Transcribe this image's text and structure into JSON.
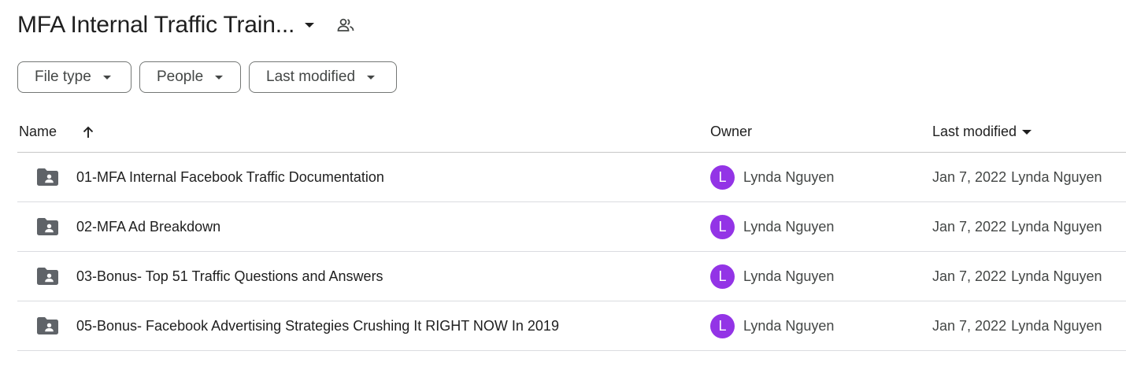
{
  "header": {
    "title": "MFA Internal Traffic Train...",
    "title_menu_icon": "caret-down-icon",
    "shared_icon": "people-icon"
  },
  "filters": [
    {
      "label": "File type"
    },
    {
      "label": "People"
    },
    {
      "label": "Last modified"
    }
  ],
  "table": {
    "columns": {
      "name": "Name",
      "owner": "Owner",
      "last_modified": "Last modified"
    },
    "sort": {
      "column": "Name",
      "direction": "ascending",
      "icon": "arrow-up-icon"
    },
    "rows": [
      {
        "icon": "shared-folder-icon",
        "name": "01-MFA Internal Facebook Traffic Documentation",
        "owner_initial": "L",
        "owner": "Lynda Nguyen",
        "modified_date": "Jan 7, 2022",
        "modified_by": "Lynda Nguyen"
      },
      {
        "icon": "shared-folder-icon",
        "name": "02-MFA Ad Breakdown",
        "owner_initial": "L",
        "owner": "Lynda Nguyen",
        "modified_date": "Jan 7, 2022",
        "modified_by": "Lynda Nguyen"
      },
      {
        "icon": "shared-folder-icon",
        "name": "03-Bonus- Top 51 Traffic Questions and Answers",
        "owner_initial": "L",
        "owner": "Lynda Nguyen",
        "modified_date": "Jan 7, 2022",
        "modified_by": "Lynda Nguyen"
      },
      {
        "icon": "shared-folder-icon",
        "name": "05-Bonus- Facebook Advertising Strategies Crushing It RIGHT NOW In 2019",
        "owner_initial": "L",
        "owner": "Lynda Nguyen",
        "modified_date": "Jan 7, 2022",
        "modified_by": "Lynda Nguyen"
      }
    ]
  },
  "colors": {
    "avatar": "#9334e6",
    "text_primary": "#1f1f1f",
    "text_secondary": "#444746",
    "icon": "#5f6368",
    "divider": "#c7c7c7"
  }
}
